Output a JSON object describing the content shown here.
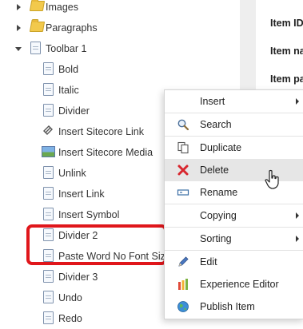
{
  "tree": {
    "items": [
      {
        "label": "Images",
        "icon": "folder-icon",
        "toggle": "collapsed"
      },
      {
        "label": "Paragraphs",
        "icon": "folder-icon",
        "toggle": "collapsed"
      },
      {
        "label": "Toolbar 1",
        "icon": "document-icon",
        "toggle": "expanded"
      },
      {
        "label": "Bold",
        "icon": "document-icon"
      },
      {
        "label": "Italic",
        "icon": "document-icon"
      },
      {
        "label": "Divider",
        "icon": "document-icon"
      },
      {
        "label": "Insert Sitecore Link",
        "icon": "link-icon"
      },
      {
        "label": "Insert Sitecore Media",
        "icon": "media-icon"
      },
      {
        "label": "Unlink",
        "icon": "document-icon"
      },
      {
        "label": "Insert Link",
        "icon": "document-icon"
      },
      {
        "label": "Insert Symbol",
        "icon": "document-icon"
      },
      {
        "label": "Divider 2",
        "icon": "document-icon"
      },
      {
        "label": "Paste Word No Font Size",
        "icon": "document-icon"
      },
      {
        "label": "Divider 3",
        "icon": "document-icon"
      },
      {
        "label": "Undo",
        "icon": "document-icon"
      },
      {
        "label": "Redo",
        "icon": "document-icon"
      }
    ]
  },
  "fields": {
    "item_id": "Item ID",
    "item_name": "Item na",
    "item_path": "Item pa"
  },
  "context_menu": {
    "items": [
      {
        "label": "Insert",
        "submenu": true
      },
      {
        "label": "Search",
        "icon": "magnifier-icon"
      },
      {
        "label": "Duplicate",
        "icon": "duplicate-icon"
      },
      {
        "label": "Delete",
        "icon": "delete-x-icon"
      },
      {
        "label": "Rename",
        "icon": "rename-icon"
      },
      {
        "label": "Copying",
        "submenu": true
      },
      {
        "label": "Sorting",
        "submenu": true
      },
      {
        "label": "Edit",
        "icon": "pencil-icon"
      },
      {
        "label": "Experience Editor",
        "icon": "experience-editor-icon"
      },
      {
        "label": "Publish Item",
        "icon": "globe-icon"
      }
    ]
  },
  "colors": {
    "highlight": "#e0161b",
    "hover": "#e6e6e6",
    "delete_icon": "#d8262e"
  }
}
